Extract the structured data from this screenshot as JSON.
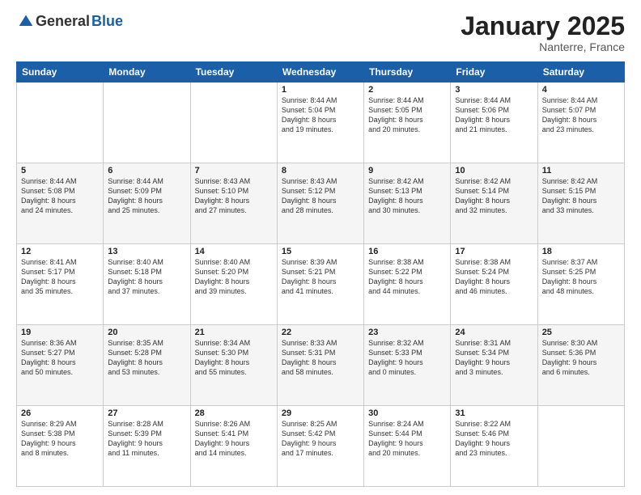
{
  "logo": {
    "general": "General",
    "blue": "Blue"
  },
  "title": "January 2025",
  "subtitle": "Nanterre, France",
  "days_of_week": [
    "Sunday",
    "Monday",
    "Tuesday",
    "Wednesday",
    "Thursday",
    "Friday",
    "Saturday"
  ],
  "weeks": [
    [
      {
        "num": "",
        "info": ""
      },
      {
        "num": "",
        "info": ""
      },
      {
        "num": "",
        "info": ""
      },
      {
        "num": "1",
        "info": "Sunrise: 8:44 AM\nSunset: 5:04 PM\nDaylight: 8 hours\nand 19 minutes."
      },
      {
        "num": "2",
        "info": "Sunrise: 8:44 AM\nSunset: 5:05 PM\nDaylight: 8 hours\nand 20 minutes."
      },
      {
        "num": "3",
        "info": "Sunrise: 8:44 AM\nSunset: 5:06 PM\nDaylight: 8 hours\nand 21 minutes."
      },
      {
        "num": "4",
        "info": "Sunrise: 8:44 AM\nSunset: 5:07 PM\nDaylight: 8 hours\nand 23 minutes."
      }
    ],
    [
      {
        "num": "5",
        "info": "Sunrise: 8:44 AM\nSunset: 5:08 PM\nDaylight: 8 hours\nand 24 minutes."
      },
      {
        "num": "6",
        "info": "Sunrise: 8:44 AM\nSunset: 5:09 PM\nDaylight: 8 hours\nand 25 minutes."
      },
      {
        "num": "7",
        "info": "Sunrise: 8:43 AM\nSunset: 5:10 PM\nDaylight: 8 hours\nand 27 minutes."
      },
      {
        "num": "8",
        "info": "Sunrise: 8:43 AM\nSunset: 5:12 PM\nDaylight: 8 hours\nand 28 minutes."
      },
      {
        "num": "9",
        "info": "Sunrise: 8:42 AM\nSunset: 5:13 PM\nDaylight: 8 hours\nand 30 minutes."
      },
      {
        "num": "10",
        "info": "Sunrise: 8:42 AM\nSunset: 5:14 PM\nDaylight: 8 hours\nand 32 minutes."
      },
      {
        "num": "11",
        "info": "Sunrise: 8:42 AM\nSunset: 5:15 PM\nDaylight: 8 hours\nand 33 minutes."
      }
    ],
    [
      {
        "num": "12",
        "info": "Sunrise: 8:41 AM\nSunset: 5:17 PM\nDaylight: 8 hours\nand 35 minutes."
      },
      {
        "num": "13",
        "info": "Sunrise: 8:40 AM\nSunset: 5:18 PM\nDaylight: 8 hours\nand 37 minutes."
      },
      {
        "num": "14",
        "info": "Sunrise: 8:40 AM\nSunset: 5:20 PM\nDaylight: 8 hours\nand 39 minutes."
      },
      {
        "num": "15",
        "info": "Sunrise: 8:39 AM\nSunset: 5:21 PM\nDaylight: 8 hours\nand 41 minutes."
      },
      {
        "num": "16",
        "info": "Sunrise: 8:38 AM\nSunset: 5:22 PM\nDaylight: 8 hours\nand 44 minutes."
      },
      {
        "num": "17",
        "info": "Sunrise: 8:38 AM\nSunset: 5:24 PM\nDaylight: 8 hours\nand 46 minutes."
      },
      {
        "num": "18",
        "info": "Sunrise: 8:37 AM\nSunset: 5:25 PM\nDaylight: 8 hours\nand 48 minutes."
      }
    ],
    [
      {
        "num": "19",
        "info": "Sunrise: 8:36 AM\nSunset: 5:27 PM\nDaylight: 8 hours\nand 50 minutes."
      },
      {
        "num": "20",
        "info": "Sunrise: 8:35 AM\nSunset: 5:28 PM\nDaylight: 8 hours\nand 53 minutes."
      },
      {
        "num": "21",
        "info": "Sunrise: 8:34 AM\nSunset: 5:30 PM\nDaylight: 8 hours\nand 55 minutes."
      },
      {
        "num": "22",
        "info": "Sunrise: 8:33 AM\nSunset: 5:31 PM\nDaylight: 8 hours\nand 58 minutes."
      },
      {
        "num": "23",
        "info": "Sunrise: 8:32 AM\nSunset: 5:33 PM\nDaylight: 9 hours\nand 0 minutes."
      },
      {
        "num": "24",
        "info": "Sunrise: 8:31 AM\nSunset: 5:34 PM\nDaylight: 9 hours\nand 3 minutes."
      },
      {
        "num": "25",
        "info": "Sunrise: 8:30 AM\nSunset: 5:36 PM\nDaylight: 9 hours\nand 6 minutes."
      }
    ],
    [
      {
        "num": "26",
        "info": "Sunrise: 8:29 AM\nSunset: 5:38 PM\nDaylight: 9 hours\nand 8 minutes."
      },
      {
        "num": "27",
        "info": "Sunrise: 8:28 AM\nSunset: 5:39 PM\nDaylight: 9 hours\nand 11 minutes."
      },
      {
        "num": "28",
        "info": "Sunrise: 8:26 AM\nSunset: 5:41 PM\nDaylight: 9 hours\nand 14 minutes."
      },
      {
        "num": "29",
        "info": "Sunrise: 8:25 AM\nSunset: 5:42 PM\nDaylight: 9 hours\nand 17 minutes."
      },
      {
        "num": "30",
        "info": "Sunrise: 8:24 AM\nSunset: 5:44 PM\nDaylight: 9 hours\nand 20 minutes."
      },
      {
        "num": "31",
        "info": "Sunrise: 8:22 AM\nSunset: 5:46 PM\nDaylight: 9 hours\nand 23 minutes."
      },
      {
        "num": "",
        "info": ""
      }
    ]
  ]
}
